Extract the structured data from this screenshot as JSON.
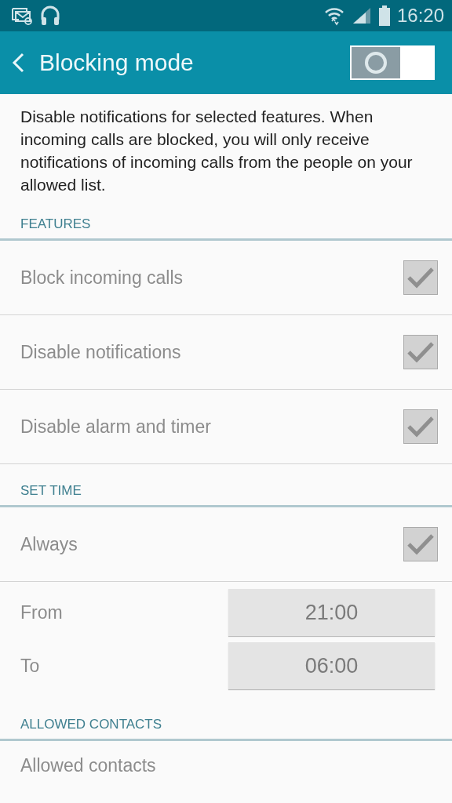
{
  "status_bar": {
    "time": "16:20"
  },
  "app_bar": {
    "title": "Blocking mode",
    "switch_on": false
  },
  "description": "Disable notifications for selected features. When incoming calls are blocked, you will only receive notifications of incoming calls from the people on your allowed list.",
  "sections": [
    {
      "header": "FEATURES",
      "items": [
        {
          "kind": "checkbox",
          "label": "Block incoming calls",
          "checked": true,
          "disabled": true
        },
        {
          "kind": "checkbox",
          "label": "Disable notifications",
          "checked": true,
          "disabled": true
        },
        {
          "kind": "checkbox",
          "label": "Disable alarm and timer",
          "checked": true,
          "disabled": true
        }
      ]
    },
    {
      "header": "SET TIME",
      "items": [
        {
          "kind": "checkbox",
          "label": "Always",
          "checked": true,
          "disabled": true
        },
        {
          "kind": "times",
          "disabled": true,
          "times": [
            {
              "label": "From",
              "value": "21:00"
            },
            {
              "label": "To",
              "value": "06:00"
            }
          ]
        }
      ]
    },
    {
      "header": "ALLOWED CONTACTS",
      "items": [
        {
          "kind": "link",
          "label": "Allowed contacts",
          "disabled": true
        }
      ]
    }
  ]
}
